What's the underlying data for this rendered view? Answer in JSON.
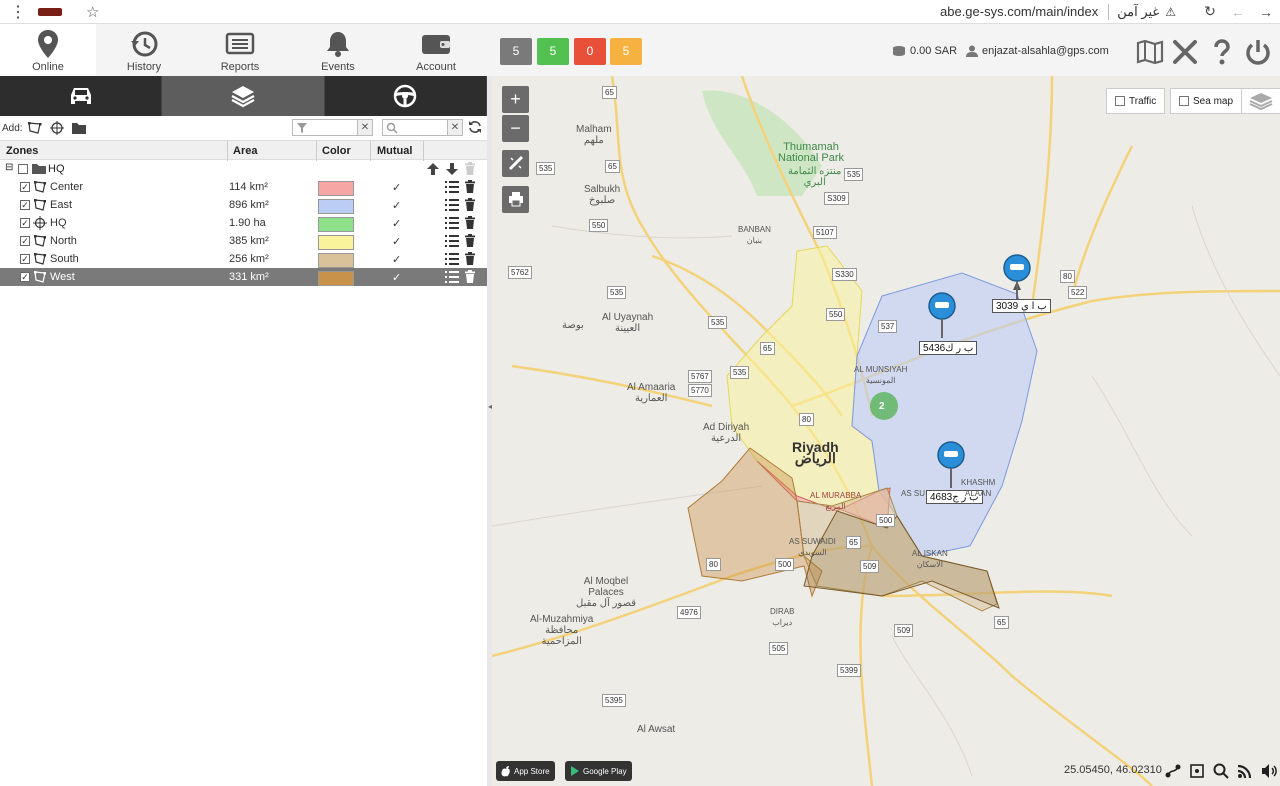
{
  "browser": {
    "url": "abe.ge-sys.com/main/index",
    "insecure_label": "غير آمن",
    "menu_glyph": "⋮",
    "star_glyph": "☆",
    "warn_glyph": "⚠",
    "reload_glyph": "↻",
    "back_glyph": "←",
    "forward_glyph": "→"
  },
  "nav": {
    "items": [
      {
        "label": "Online",
        "icon": "map-pin-icon"
      },
      {
        "label": "History",
        "icon": "history-icon"
      },
      {
        "label": "Reports",
        "icon": "reports-icon"
      },
      {
        "label": "Events",
        "icon": "bell-icon"
      },
      {
        "label": "Account",
        "icon": "wallet-icon"
      }
    ],
    "status_counts": [
      {
        "value": "5",
        "color": "#7a7a7a"
      },
      {
        "value": "5",
        "color": "#52c152"
      },
      {
        "value": "0",
        "color": "#e8503a"
      },
      {
        "value": "5",
        "color": "#f5b240"
      }
    ],
    "balance": "0.00 SAR",
    "user_email": "enjazat-alsahla@gps.com"
  },
  "panel": {
    "tabs": [
      "car-icon",
      "layers-icon",
      "steering-wheel-icon"
    ],
    "add_label": "Add:",
    "filter_clear_glyph": "✕",
    "columns": {
      "zones": "Zones",
      "area": "Area",
      "color": "Color",
      "mutual": "Mutual"
    },
    "group": {
      "name": "HQ",
      "expand_glyph": "⊟"
    },
    "check_glyph": "✓",
    "zones": [
      {
        "name": "Center",
        "area": "114 km²",
        "color": "#f7a6a6",
        "mutual": "✓",
        "shape": "polygon-icon"
      },
      {
        "name": "East",
        "area": "896 km²",
        "color": "#bccdf5",
        "mutual": "✓",
        "shape": "polygon-icon"
      },
      {
        "name": "HQ",
        "area": "1.90 ha",
        "color": "#8ee08a",
        "mutual": "✓",
        "shape": "circle-icon"
      },
      {
        "name": "North",
        "area": "385 km²",
        "color": "#f9f39c",
        "mutual": "✓",
        "shape": "polygon-icon"
      },
      {
        "name": "South",
        "area": "256 km²",
        "color": "#d9c29a",
        "mutual": "✓",
        "shape": "polygon-icon"
      },
      {
        "name": "West",
        "area": "331 km²",
        "color": "#c8924a",
        "mutual": "✓",
        "shape": "polygon-icon",
        "selected": true
      }
    ]
  },
  "map": {
    "zoom_in": "+",
    "zoom_out": "−",
    "traffic_label": "Traffic",
    "sea_map_label": "Sea map",
    "cluster_count": "2",
    "vehicles": [
      {
        "plate": "ب ا ي 3039"
      },
      {
        "plate": "ب ر ك5436"
      },
      {
        "plate": "ب ر ج4683"
      }
    ],
    "places": [
      {
        "name": "Malham\nملهم"
      },
      {
        "name": "Thumamah\nNational Park"
      },
      {
        "name": "منتزه الثمامة\nالبري"
      },
      {
        "name": "Salbukh\nصلبوخ"
      },
      {
        "name": "BANBAN\nبنبان"
      },
      {
        "name": "Al Uyaynah\nالعيينة"
      },
      {
        "name": "بوصة"
      },
      {
        "name": "Al Amaaria\nالعمارية"
      },
      {
        "name": "Ad Diriyah\nالدرعية"
      },
      {
        "name": "Riyadh\nالرياض"
      },
      {
        "name": "AL MUNSIYAH\nالمونسية"
      },
      {
        "name": "AL MURABBA\nالمربع"
      },
      {
        "name": "AS SUWAIDI\nالسويدي"
      },
      {
        "name": "KHASHM\nALAAN"
      },
      {
        "name": "AL ISKAN\nالاسكان"
      },
      {
        "name": "AS SU"
      },
      {
        "name": "Al Moqbel\nPalaces\nقصور آل مقبل"
      },
      {
        "name": "Al-Muzahmiya\nمحافظة\nالمزاحمية"
      },
      {
        "name": "DIRAB\nديراب"
      },
      {
        "name": "Al Awsat"
      }
    ],
    "roads": [
      "65",
      "535",
      "65",
      "535",
      "S309",
      "550",
      "5107",
      "535",
      "S330",
      "550",
      "537",
      "80",
      "522",
      "5762",
      "535",
      "65",
      "535",
      "5767",
      "5770",
      "80",
      "500",
      "65",
      "80",
      "500",
      "509",
      "4976",
      "505",
      "509",
      "65",
      "5399",
      "5395"
    ],
    "coords": "25.05450, 46.02310",
    "app_store": "App Store",
    "google_play": "Google Play"
  }
}
